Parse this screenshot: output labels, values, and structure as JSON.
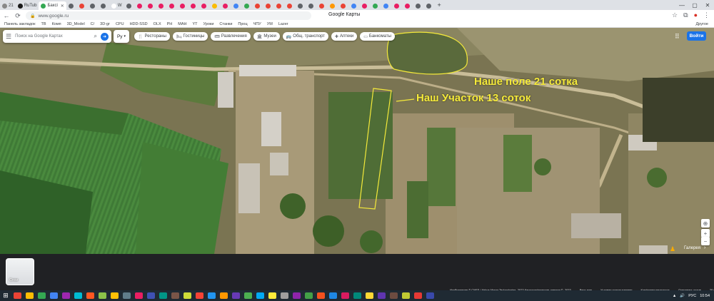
{
  "tabs": [
    {
      "label": "21",
      "color": "#888888"
    },
    {
      "label": "RuTub",
      "color": "#1a1a1a"
    },
    {
      "label": "Баксі",
      "color": "#34a853",
      "active": true
    },
    {
      "label": "",
      "color": "#5f6368"
    },
    {
      "label": "",
      "color": "#ea4335"
    },
    {
      "label": "",
      "color": "#5f6368"
    },
    {
      "label": "",
      "color": "#5f6368"
    },
    {
      "label": "W",
      "color": "#ffffff"
    },
    {
      "label": "",
      "color": "#5f6368"
    },
    {
      "label": "",
      "color": "#e91e63"
    },
    {
      "label": "",
      "color": "#e91e63"
    },
    {
      "label": "",
      "color": "#e91e63"
    },
    {
      "label": "",
      "color": "#e91e63"
    },
    {
      "label": "",
      "color": "#e91e63"
    },
    {
      "label": "",
      "color": "#e91e63"
    },
    {
      "label": "",
      "color": "#e91e63"
    },
    {
      "label": "",
      "color": "#fbbc04"
    },
    {
      "label": "",
      "color": "#e91e63"
    },
    {
      "label": "",
      "color": "#4285f4"
    },
    {
      "label": "",
      "color": "#34a853"
    },
    {
      "label": "",
      "color": "#ea4335"
    },
    {
      "label": "",
      "color": "#ea4335"
    },
    {
      "label": "",
      "color": "#ea4335"
    },
    {
      "label": "",
      "color": "#ea4335"
    },
    {
      "label": "",
      "color": "#5f6368"
    },
    {
      "label": "",
      "color": "#5f6368"
    },
    {
      "label": "",
      "color": "#ea4335"
    },
    {
      "label": "",
      "color": "#ff9800"
    },
    {
      "label": "",
      "color": "#ea4335"
    },
    {
      "label": "",
      "color": "#4285f4"
    },
    {
      "label": "",
      "color": "#e91e63"
    },
    {
      "label": "",
      "color": "#34a853"
    },
    {
      "label": "",
      "color": "#4285f4"
    },
    {
      "label": "",
      "color": "#e91e63"
    },
    {
      "label": "",
      "color": "#e91e63"
    },
    {
      "label": "",
      "color": "#5f6368"
    },
    {
      "label": "",
      "color": "#5f6368"
    }
  ],
  "window": {
    "minimize": "—",
    "maximize": "▢",
    "close": "✕"
  },
  "omnibar": {
    "back": "←",
    "reload": "⟳",
    "url_scheme": "https://",
    "url": "www.google.ru",
    "page_title": "Google Карты"
  },
  "bookmarks": {
    "items": [
      "Панель закладок",
      "ТВ",
      "Комп",
      "3D_Model",
      "С/",
      "3D-gr",
      "CPU",
      "HDD-SSD",
      "OLX",
      "PH",
      "МАН",
      "YT",
      "Уроки",
      "Станки",
      "Проц",
      "ЧПУ",
      "УМ",
      "Lazer"
    ],
    "other": "Другое"
  },
  "maps": {
    "search_placeholder": "Поиск на Google Картах",
    "lang": "Ру",
    "chips": [
      {
        "icon": "fork-knife-icon",
        "glyph": "🍴",
        "label": "Рестораны"
      },
      {
        "icon": "bed-icon",
        "glyph": "🛏",
        "label": "Гостиницы"
      },
      {
        "icon": "ticket-icon",
        "glyph": "🎟",
        "label": "Развлечения"
      },
      {
        "icon": "museum-icon",
        "glyph": "🏛",
        "label": "Музеи"
      },
      {
        "icon": "bus-icon",
        "glyph": "🚌",
        "label": "Общ. транспорт"
      },
      {
        "icon": "pharmacy-icon",
        "glyph": "✚",
        "label": "Аптеки"
      },
      {
        "icon": "atm-icon",
        "glyph": "▭",
        "label": "Банкоматы"
      }
    ],
    "signin": "Войти",
    "annotations": {
      "field": "Наше поле 21 сотка",
      "plot": "Наш Участок 13 соток"
    },
    "gallery": "Галерея",
    "layers_label": "Слои",
    "attribution": [
      "Изображения © CNES / Airbus,Maxar Technologies, 2023,Картографические данные ©, 2023",
      "Весь мир",
      "Условия использования",
      "Конфиденциальность",
      "Отправить отзыв",
      "20 м"
    ],
    "colors": {
      "annotation": "#f5ea3a",
      "signin": "#1a73e8"
    }
  },
  "taskbar": {
    "icons": [
      "#ea4335",
      "#fbbc04",
      "#34a853",
      "#4285f4",
      "#9c27b0",
      "#00bcd4",
      "#ff5722",
      "#8bc34a",
      "#ffc107",
      "#607d8b",
      "#e91e63",
      "#3f51b5",
      "#009688",
      "#795548",
      "#cddc39",
      "#f44336",
      "#2196f3",
      "#ff9800",
      "#673ab7",
      "#4caf50",
      "#03a9f4",
      "#ffeb3b",
      "#9e9e9e",
      "#8e24aa",
      "#43a047",
      "#f4511e",
      "#1e88e5",
      "#d81b60",
      "#00897b",
      "#fdd835",
      "#5e35b1",
      "#6d4c41",
      "#c0ca33",
      "#e53935",
      "#3949ab"
    ],
    "lang": "РУС",
    "time": "10:54"
  }
}
